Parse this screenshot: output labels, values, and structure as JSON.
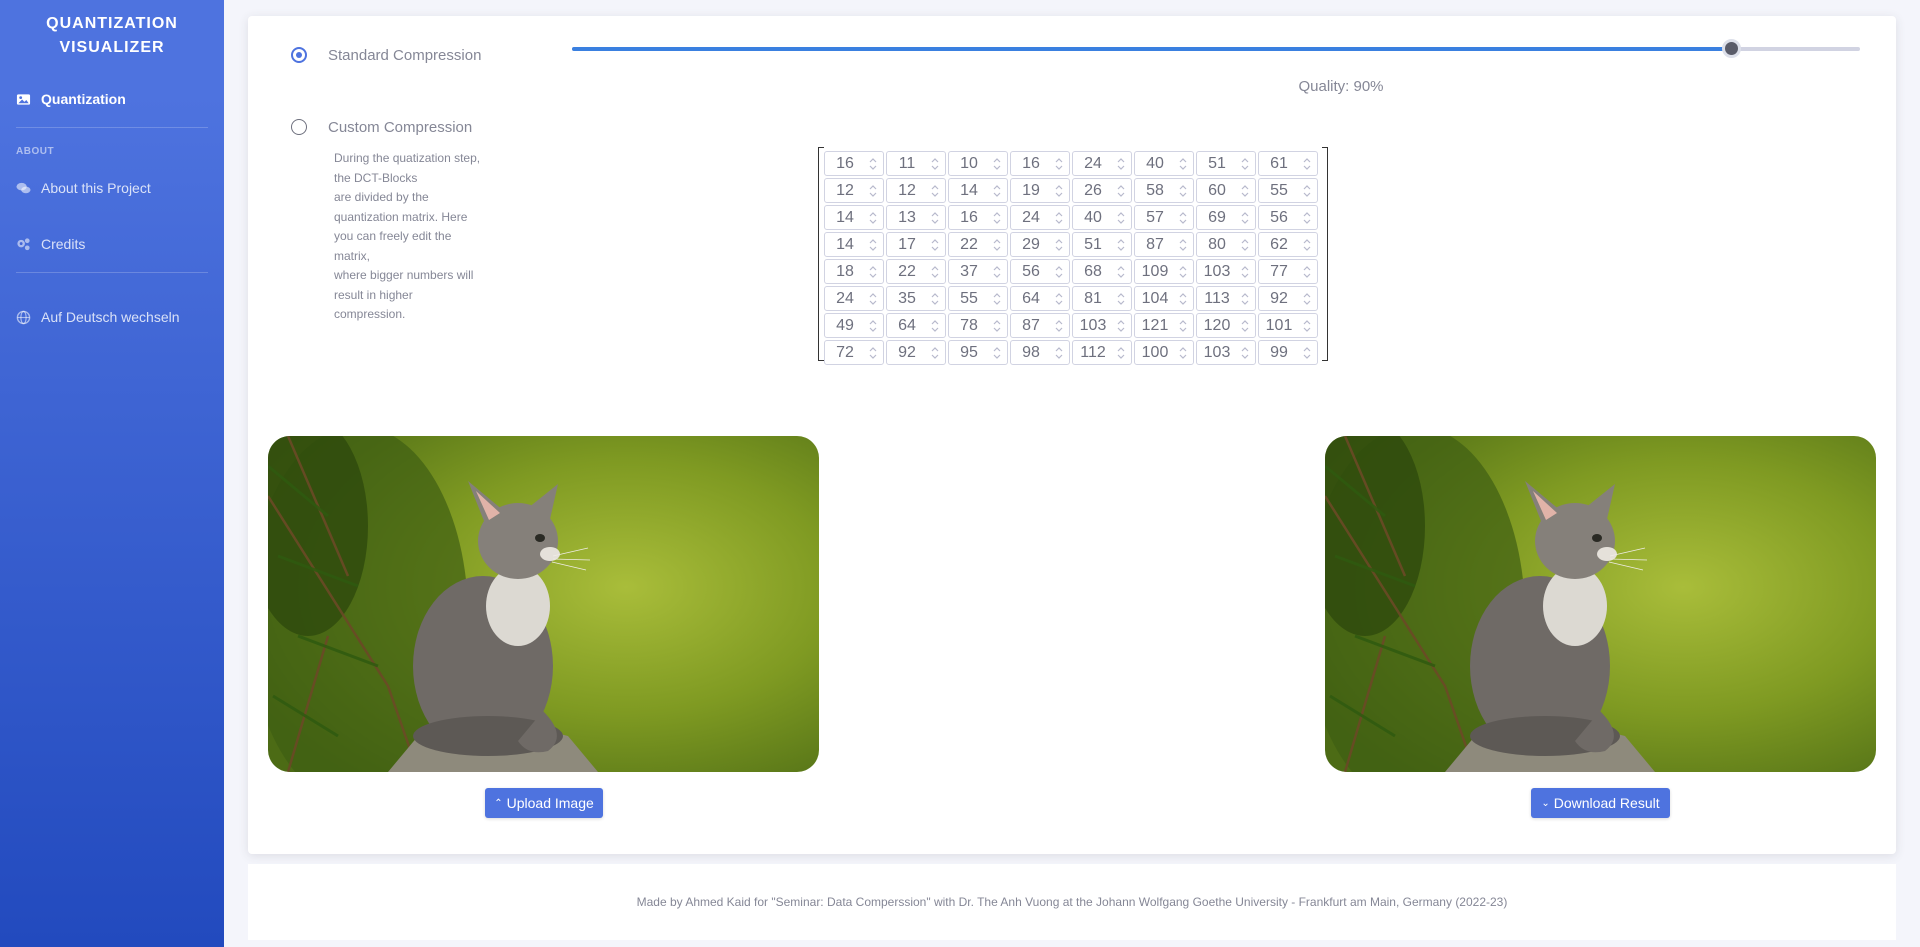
{
  "sidebar": {
    "brand": "QUANTIZATION VISUALIZER",
    "nav_main": [
      {
        "label": "Quantization",
        "icon": "image-icon"
      }
    ],
    "section_heading": "ABOUT",
    "nav_about": [
      {
        "label": "About this Project",
        "icon": "comments-icon"
      },
      {
        "label": "Credits",
        "icon": "cogs-icon"
      }
    ],
    "language_link": {
      "label": "Auf Deutsch wechseln",
      "icon": "globe-icon"
    }
  },
  "compression": {
    "standard_label": "Standard Compression",
    "custom_label": "Custom Compression",
    "selected": "standard",
    "quality_text": "Quality: 90%",
    "quality_value": 0.9,
    "custom_description": [
      "During the quatization step,",
      "the DCT-Blocks",
      "are divided by the",
      "quantization matrix. Here",
      "you can freely edit the",
      "matrix,",
      "where bigger numbers will",
      "result in higher",
      "compression."
    ]
  },
  "matrix": [
    [
      16,
      11,
      10,
      16,
      24,
      40,
      51,
      61
    ],
    [
      12,
      12,
      14,
      19,
      26,
      58,
      60,
      55
    ],
    [
      14,
      13,
      16,
      24,
      40,
      57,
      69,
      56
    ],
    [
      14,
      17,
      22,
      29,
      51,
      87,
      80,
      62
    ],
    [
      18,
      22,
      37,
      56,
      68,
      109,
      103,
      77
    ],
    [
      24,
      35,
      55,
      64,
      81,
      104,
      113,
      92
    ],
    [
      49,
      64,
      78,
      87,
      103,
      121,
      120,
      101
    ],
    [
      72,
      92,
      95,
      98,
      112,
      100,
      103,
      99
    ]
  ],
  "buttons": {
    "upload": "Upload Image",
    "download": "Download Result"
  },
  "footer": "Made by Ahmed Kaid for \"Seminar: Data Comperssion\" with Dr. The Anh Vuong at the Johann Wolfgang Goethe University - Frankfurt am Main, Germany (2022-23)"
}
